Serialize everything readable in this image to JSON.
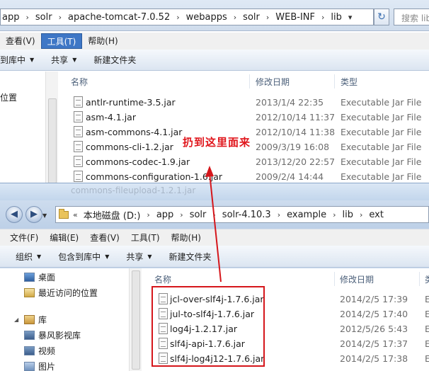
{
  "back_window": {
    "breadcrumb": [
      "app",
      "solr",
      "apache-tomcat-7.0.52",
      "webapps",
      "solr",
      "WEB-INF",
      "lib"
    ],
    "search_placeholder": "搜索 lib",
    "menu": [
      "查看(V)",
      "工具(T)",
      "帮助(H)"
    ],
    "toolbar": [
      "到库中",
      "共享",
      "新建文件夹"
    ],
    "nav_label": "位置",
    "columns": {
      "name": "名称",
      "date": "修改日期",
      "type": "类型"
    },
    "files": [
      {
        "name": "antlr-runtime-3.5.jar",
        "date": "2013/1/4 22:35",
        "type": "Executable Jar File"
      },
      {
        "name": "asm-4.1.jar",
        "date": "2012/10/14 11:37",
        "type": "Executable Jar File"
      },
      {
        "name": "asm-commons-4.1.jar",
        "date": "2012/10/14 11:38",
        "type": "Executable Jar File"
      },
      {
        "name": "commons-cli-1.2.jar",
        "date": "2009/3/19 16:08",
        "type": "Executable Jar File"
      },
      {
        "name": "commons-codec-1.9.jar",
        "date": "2013/12/20 22:57",
        "type": "Executable Jar File"
      },
      {
        "name": "commons-configuration-1.6.jar",
        "date": "2009/2/4 14:44",
        "type": "Executable Jar File"
      }
    ]
  },
  "front_window": {
    "ghost_row": "commons-fileupload-1.2.1.jar",
    "breadcrumb": [
      "本地磁盘 (D:)",
      "app",
      "solr",
      "solr-4.10.3",
      "example",
      "lib",
      "ext"
    ],
    "menu": [
      "文件(F)",
      "编辑(E)",
      "查看(V)",
      "工具(T)",
      "帮助(H)"
    ],
    "toolbar": [
      "组织",
      "包含到库中",
      "共享",
      "新建文件夹"
    ],
    "nav": [
      "桌面",
      "最近访问的位置",
      "库",
      "暴风影视库",
      "视频",
      "图片"
    ],
    "columns": {
      "name": "名称",
      "date": "修改日期",
      "type": "类型"
    },
    "files": [
      {
        "name": "jcl-over-slf4j-1.7.6.jar",
        "date": "2014/2/5 17:39",
        "type": "E"
      },
      {
        "name": "jul-to-slf4j-1.7.6.jar",
        "date": "2014/2/5 17:40",
        "type": "E"
      },
      {
        "name": "log4j-1.2.17.jar",
        "date": "2012/5/26 5:43",
        "type": "E"
      },
      {
        "name": "slf4j-api-1.7.6.jar",
        "date": "2014/2/5 17:37",
        "type": "E"
      },
      {
        "name": "slf4j-log4j12-1.7.6.jar",
        "date": "2014/2/5 17:38",
        "type": "E"
      }
    ]
  },
  "annotation": {
    "text": "扔到这里面来",
    "color": "#e0161c"
  }
}
